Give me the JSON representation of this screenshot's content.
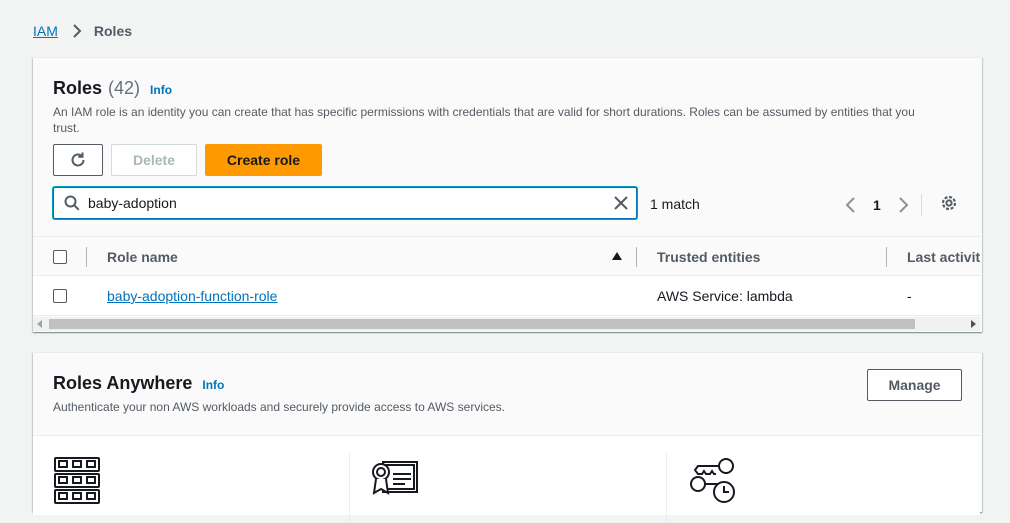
{
  "breadcrumb": {
    "root": "IAM",
    "current": "Roles"
  },
  "roles": {
    "title": "Roles",
    "count": "(42)",
    "info": "Info",
    "description_line1": "An IAM role is an identity you can create that has specific permissions with credentials that are valid for short durations. Roles can be assumed by entities that you",
    "description_line2": "trust.",
    "buttons": {
      "delete": "Delete",
      "create": "Create role"
    },
    "search": {
      "value": "baby-adoption",
      "placeholder": ""
    },
    "match_count": "1 match",
    "pagination": {
      "current_page": "1"
    },
    "table": {
      "columns": [
        "Role name",
        "Trusted entities",
        "Last activity"
      ],
      "sort_direction": "ascending",
      "rows": [
        {
          "role_name": "baby-adoption-function-role",
          "trusted_entities": "AWS Service: lambda",
          "last_activity": "-"
        }
      ]
    }
  },
  "roles_anywhere": {
    "title": "Roles Anywhere",
    "info": "Info",
    "description": "Authenticate your non AWS workloads and securely provide access to AWS services.",
    "manage_label": "Manage",
    "feature_icons": [
      "server-rack-icon",
      "certificate-icon",
      "keys-clock-icon"
    ]
  },
  "colors": {
    "link": "#0073bb",
    "primary_button": "#ff9900",
    "page_bg": "#f2f3f3"
  }
}
